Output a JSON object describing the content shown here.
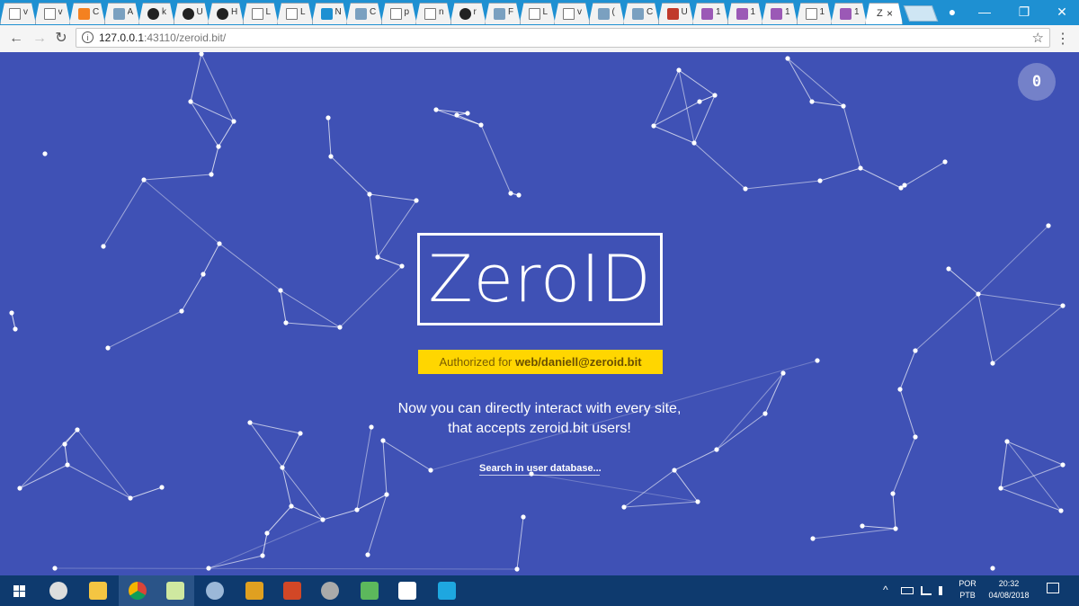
{
  "browser": {
    "tabs": [
      {
        "label": "v",
        "icon": "page-icon"
      },
      {
        "label": "v",
        "icon": "page-icon"
      },
      {
        "label": "C",
        "icon": "cloud-icon"
      },
      {
        "label": "A",
        "icon": "app-icon"
      },
      {
        "label": "k",
        "icon": "github-icon"
      },
      {
        "label": "U",
        "icon": "github-icon"
      },
      {
        "label": "H",
        "icon": "github-icon"
      },
      {
        "label": "L",
        "icon": "page-icon"
      },
      {
        "label": "L",
        "icon": "page-icon"
      },
      {
        "label": "N",
        "icon": "net-icon"
      },
      {
        "label": "C",
        "icon": "app-icon"
      },
      {
        "label": "p",
        "icon": "page-icon"
      },
      {
        "label": "n",
        "icon": "page-icon"
      },
      {
        "label": "r",
        "icon": "github-icon"
      },
      {
        "label": "F",
        "icon": "app-icon"
      },
      {
        "label": "L",
        "icon": "page-icon"
      },
      {
        "label": "v",
        "icon": "page-icon"
      },
      {
        "label": "(",
        "icon": "app-icon"
      },
      {
        "label": "C",
        "icon": "app-icon"
      },
      {
        "label": "U",
        "icon": "shield-icon"
      },
      {
        "label": "1",
        "icon": "hexagon-icon"
      },
      {
        "label": "1",
        "icon": "hexagon-icon"
      },
      {
        "label": "1",
        "icon": "hexagon-icon"
      },
      {
        "label": "1",
        "icon": "page-icon"
      },
      {
        "label": "1",
        "icon": "hexagon-icon"
      }
    ],
    "active_tab": {
      "label": "Z",
      "close": "×"
    },
    "window_controls": {
      "minimize": "—",
      "restore": "❐",
      "close": "✕",
      "profile": "●"
    },
    "nav": {
      "back": "←",
      "forward": "→",
      "reload": "↻"
    },
    "address": {
      "host": "127.0.0.1",
      "rest": ":43110/zeroid.bit/",
      "info": "i",
      "star": "☆"
    },
    "menu": "⋮"
  },
  "page": {
    "badge_count": "0",
    "logo_text": "ZeroID",
    "auth_prefix": "Authorized for ",
    "auth_user": "web/daniell@zeroid.bit",
    "message_line1": "Now you can directly interact with every site,",
    "message_line2": "that accepts zeroid.bit users!",
    "search_link": "Search in user database..."
  },
  "taskbar": {
    "tray_arrow": "^",
    "language_top": "POR",
    "language_bottom": "PTB",
    "time": "20:32",
    "date": "04/08/2018"
  },
  "colors": {
    "background": "#3f51b5",
    "auth_bar": "#ffd600",
    "taskbar": "#0e3a6e",
    "tabstrip": "#1e90d2"
  }
}
